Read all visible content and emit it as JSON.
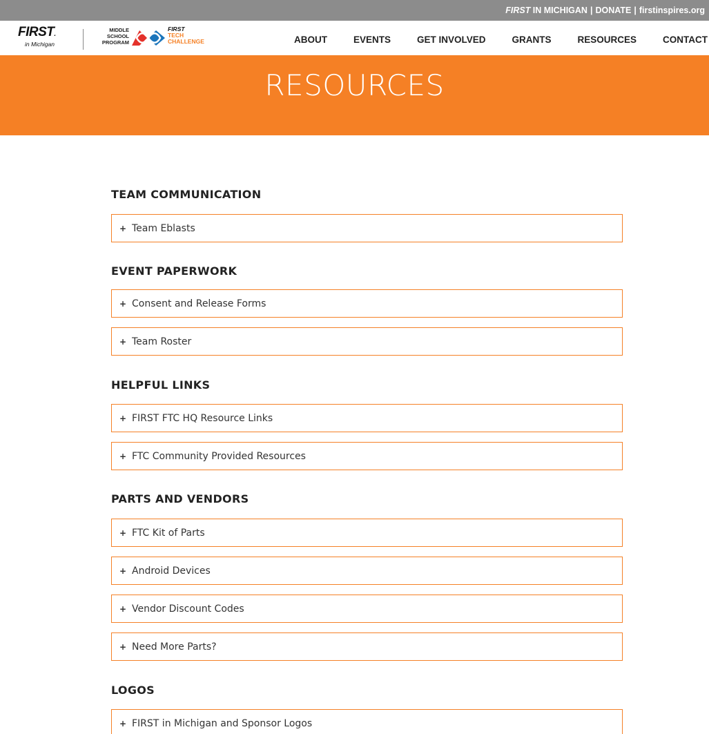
{
  "topbar": {
    "first": "FIRST",
    "in_michigan": " IN MICHIGAN",
    "separator": "|",
    "donate": "DONATE",
    "site": "firstinspires.org"
  },
  "header": {
    "logo_first": "FIRST",
    "logo_first_reg": ".",
    "logo_sub": "in Michigan",
    "logo_msp_lines": [
      "MIDDLE",
      "SCHOOL",
      "PROGRAM"
    ],
    "logo_ftc_first": "FIRST",
    "logo_ftc_lines": [
      "TECH",
      "CHALLENGE"
    ]
  },
  "nav": {
    "items": [
      "ABOUT",
      "EVENTS",
      "GET INVOLVED",
      "GRANTS",
      "RESOURCES",
      "CONTACT"
    ]
  },
  "hero": {
    "title": "RESOURCES"
  },
  "sections": [
    {
      "title": "TEAM COMMUNICATION",
      "items": [
        "Team Eblasts"
      ]
    },
    {
      "title": "EVENT PAPERWORK",
      "items": [
        "Consent and Release Forms",
        "Team Roster"
      ]
    },
    {
      "title": "HELPFUL LINKS",
      "items": [
        "FIRST FTC HQ Resource Links",
        "FTC Community Provided Resources"
      ]
    },
    {
      "title": "PARTS AND VENDORS",
      "items": [
        "FTC Kit of Parts",
        "Android Devices",
        "Vendor Discount Codes",
        "Need More Parts?"
      ]
    },
    {
      "title": "LOGOS",
      "items": [
        "FIRST in Michigan and Sponsor Logos"
      ]
    }
  ],
  "accordion_icon": "+",
  "colors": {
    "accent": "#f58025",
    "topbar": "#8c8c8c",
    "text": "#222222"
  },
  "icons": {
    "logo_mark": "ftc-infinity-logo-icon"
  }
}
